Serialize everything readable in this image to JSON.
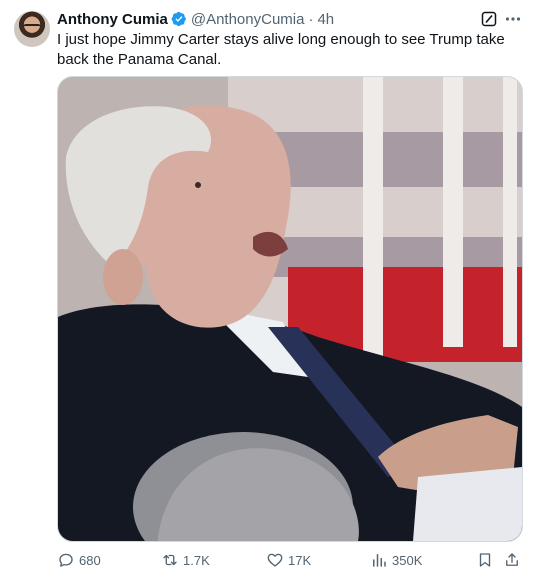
{
  "tweet": {
    "author_name": "Anthony Cumia",
    "verified": true,
    "handle": "@AnthonyCumia",
    "separator": "·",
    "time": "4h",
    "text": "I just hope Jimmy Carter stays alive long enough to see Trump take back the Panama Canal.",
    "media_icon": "photo-of-elderly-man"
  },
  "actions": {
    "replies": "680",
    "reposts": "1.7K",
    "likes": "17K",
    "views": "350K"
  },
  "colors": {
    "text": "#0f1419",
    "secondary": "#536471",
    "verified_blue": "#1d9bf0",
    "border": "#cfd9de"
  }
}
